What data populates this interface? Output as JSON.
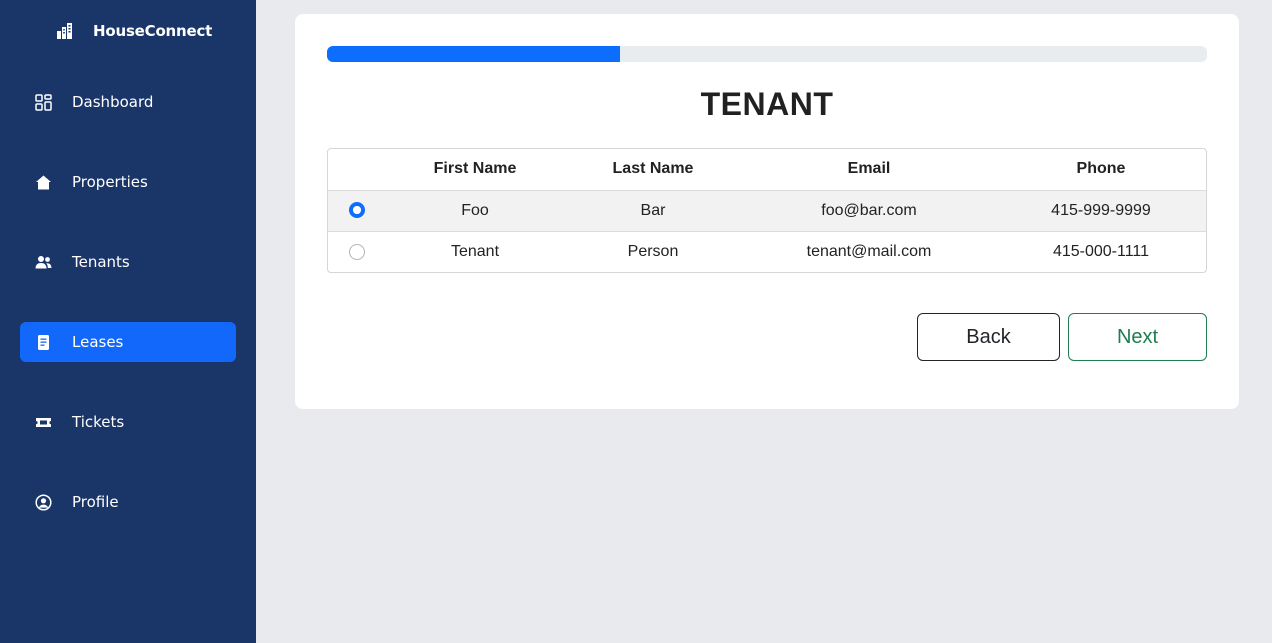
{
  "app": {
    "name": "HouseConnect"
  },
  "sidebar": {
    "items": [
      {
        "label": "Dashboard",
        "icon": "dashboard-grid-icon",
        "active": false
      },
      {
        "label": "Properties",
        "icon": "house-icon",
        "active": false
      },
      {
        "label": "Tenants",
        "icon": "people-icon",
        "active": false
      },
      {
        "label": "Leases",
        "icon": "document-icon",
        "active": true
      },
      {
        "label": "Tickets",
        "icon": "ticket-icon",
        "active": false
      },
      {
        "label": "Profile",
        "icon": "user-circle-icon",
        "active": false
      }
    ]
  },
  "wizard": {
    "progress_percent": 33.3,
    "title": "TENANT",
    "table": {
      "columns": [
        "",
        "First Name",
        "Last Name",
        "Email",
        "Phone"
      ],
      "rows": [
        {
          "first_name": "Foo",
          "last_name": "Bar",
          "email": "foo@bar.com",
          "phone": "415-999-9999",
          "selected": true
        },
        {
          "first_name": "Tenant",
          "last_name": "Person",
          "email": "tenant@mail.com",
          "phone": "415-000-1111",
          "selected": false
        }
      ]
    },
    "back_label": "Back",
    "next_label": "Next"
  },
  "colors": {
    "sidebar_bg": "#1a3568",
    "active_item": "#1268fb",
    "progress_fill": "#0d6efd",
    "next_button": "#1e7e4f"
  }
}
